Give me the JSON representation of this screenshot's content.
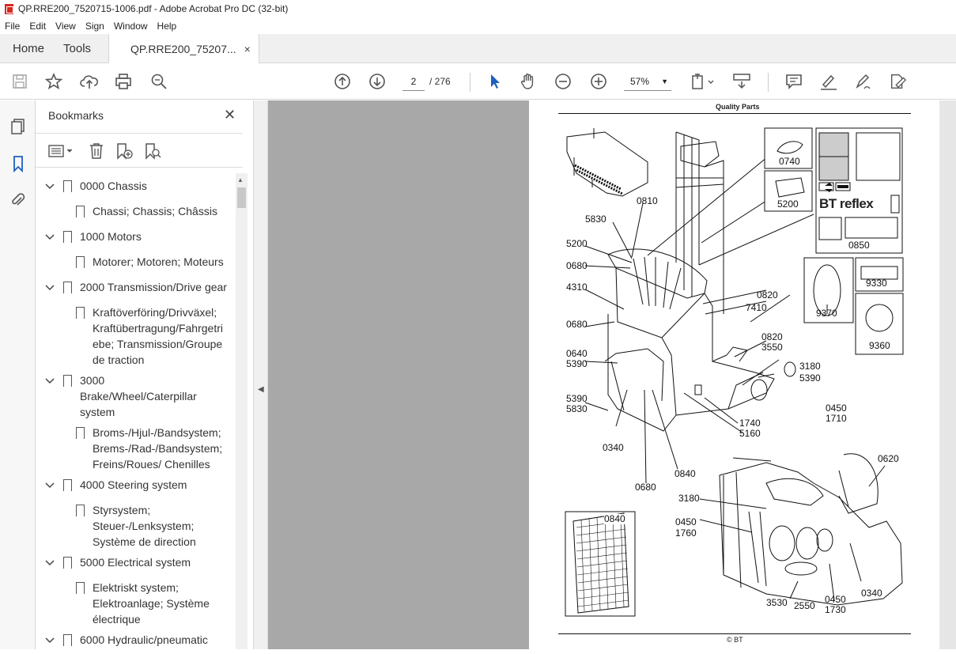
{
  "window": {
    "title": "QP.RRE200_7520715-1006.pdf - Adobe Acrobat Pro DC (32-bit)"
  },
  "menu": [
    "File",
    "Edit",
    "View",
    "Sign",
    "Window",
    "Help"
  ],
  "tabs": {
    "home": "Home",
    "tools": "Tools",
    "doc": "QP.RRE200_75207...",
    "close": "×"
  },
  "nav": {
    "page": "2",
    "total": "/ 276",
    "zoom": "57%"
  },
  "panel": {
    "title": "Bookmarks",
    "items": [
      {
        "label": "0000 Chassis",
        "level": 0
      },
      {
        "label": "Chassi; Chassis; Châssis",
        "level": 1
      },
      {
        "label": "1000 Motors",
        "level": 0
      },
      {
        "label": "Motorer; Motoren; Moteurs",
        "level": 1
      },
      {
        "label": "2000 Transmission/Drive gear",
        "level": 0
      },
      {
        "label": "Kraftöverföring/Drivväxel;",
        "level": 1
      },
      {
        "label": "Kraftübertragung/Fahrgetri",
        "level": 1
      },
      {
        "label": "ebe; Transmission/Groupe",
        "level": 1
      },
      {
        "label": "de traction",
        "level": 1
      },
      {
        "label": "3000",
        "level": 0
      },
      {
        "label": "Brake/Wheel/Caterpillar",
        "level": 0
      },
      {
        "label": "system",
        "level": 0
      },
      {
        "label": "Broms-/Hjul-/Bandsystem;",
        "level": 1
      },
      {
        "label": "Brems-/Rad-/Bandsystem;",
        "level": 1
      },
      {
        "label": "Freins/Roues/ Chenilles",
        "level": 1
      },
      {
        "label": "4000 Steering system",
        "level": 0
      },
      {
        "label": "Styrsystem;",
        "level": 1
      },
      {
        "label": "Steuer-/Lenksystem;",
        "level": 1
      },
      {
        "label": "Système de direction",
        "level": 1
      },
      {
        "label": "5000 Electrical system",
        "level": 0
      },
      {
        "label": "Elektriskt system;",
        "level": 1
      },
      {
        "label": "Elektroanlage; Système",
        "level": 1
      },
      {
        "label": "électrique",
        "level": 1
      },
      {
        "label": "6000 Hydraulic/pneumatic",
        "level": 0
      }
    ]
  },
  "pdf": {
    "header": "Quality Parts",
    "footer": "© BT",
    "brand": "BT reflex",
    "labels": [
      "0810",
      "5830",
      "5200",
      "0680",
      "4310",
      "0680",
      "0640",
      "5390",
      "5390",
      "5830",
      "0340",
      "0680",
      "0840",
      "1740",
      "5160",
      "0820",
      "7410",
      "0820",
      "3550",
      "3180",
      "5390",
      "0740",
      "5200",
      "0850",
      "9330",
      "9370",
      "9360",
      "0450",
      "1710",
      "0620",
      "3180",
      "0450",
      "1760",
      "3530",
      "2550",
      "0450",
      "1730",
      "0340",
      "0840"
    ]
  }
}
